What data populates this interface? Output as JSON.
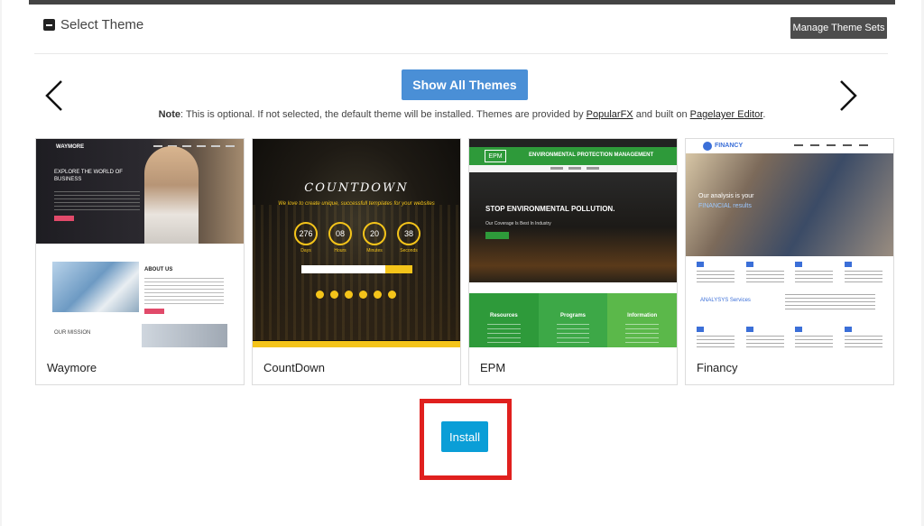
{
  "section": {
    "title": "Select Theme",
    "collapse_icon": "minus-square-icon",
    "manage_button": "Manage Theme Sets"
  },
  "toolbar": {
    "show_all_label": "Show All Themes",
    "prev_icon": "chevron-left-icon",
    "next_icon": "chevron-right-icon"
  },
  "note": {
    "prefix": "Note",
    "text": ": This is optional. If not selected, the default theme will be installed. Themes are provided by ",
    "link1": "PopularFX",
    "middle": " and built on ",
    "link2": "Pagelayer Editor",
    "suffix": "."
  },
  "themes": [
    {
      "name": "Waymore",
      "thumb": {
        "brand": "WAYMORE",
        "headline": "EXPLORE THE WORLD OF BUSINESS",
        "about": "ABOUT US",
        "mission": "OUR MISSION"
      }
    },
    {
      "name": "CountDown",
      "thumb": {
        "title": "COUNTDOWN",
        "subtitle": "We love to create unique, successfull templates for your websites",
        "timer": [
          {
            "value": "276",
            "unit": "Days"
          },
          {
            "value": "08",
            "unit": "Hours"
          },
          {
            "value": "20",
            "unit": "Minutes"
          },
          {
            "value": "38",
            "unit": "Seconds"
          }
        ]
      }
    },
    {
      "name": "EPM",
      "thumb": {
        "logo": "EPM",
        "header": "ENVIRONMENTAL PROTECTION MANAGEMENT",
        "headline": "STOP ENVIRONMENTAL POLLUTION.",
        "sub": "Our Coverage Is Best In Industry",
        "columns": [
          "Resources",
          "Programs",
          "Information"
        ],
        "column_colors": [
          "#2e9a3a",
          "#3da847",
          "#5bb84a"
        ]
      }
    },
    {
      "name": "Financy",
      "thumb": {
        "brand": "FINANCY",
        "hero_line1": "Our analysis is your",
        "hero_line2": "FINANCIAL results",
        "section": "ANALYSYS Services"
      }
    }
  ],
  "install": {
    "label": "Install",
    "highlight_color": "#e0201e"
  },
  "colors": {
    "primary_button": "#4a8fd6",
    "install_button": "#0a9ed7",
    "dark_button": "#4d4d4d"
  }
}
